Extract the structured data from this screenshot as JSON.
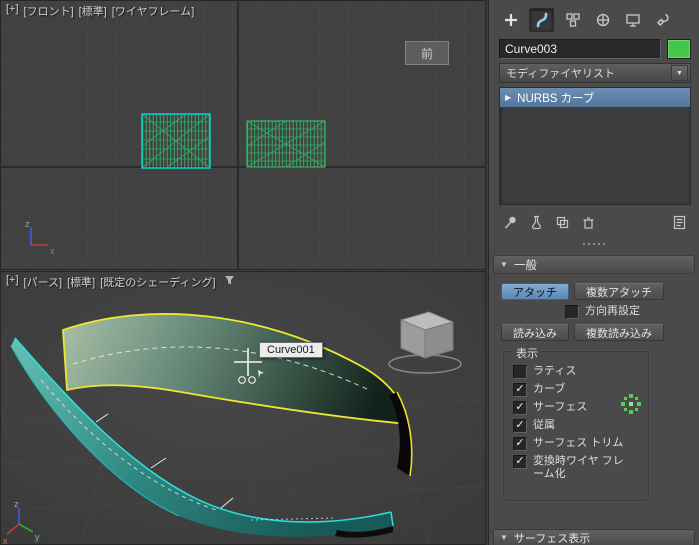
{
  "viewport_front": {
    "labels": [
      "[+]",
      "[フロント]",
      "[標準]",
      "[ワイヤフレーム]"
    ],
    "view_indicator": "前",
    "axis_labels": {
      "z": "z",
      "x": "x"
    }
  },
  "viewport_persp": {
    "labels": [
      "[+]",
      "[パース]",
      "[標準]",
      "[既定のシェーディング]"
    ],
    "tooltip": "Curve001",
    "axis_labels": {
      "z": "z",
      "x": "x",
      "y": "y"
    }
  },
  "panel": {
    "tabs": [
      {
        "name": "create"
      },
      {
        "name": "modify",
        "active": true
      },
      {
        "name": "hierarchy"
      },
      {
        "name": "motion"
      },
      {
        "name": "display"
      },
      {
        "name": "utilities"
      }
    ],
    "object_name": "Curve003",
    "object_color": "#44c648",
    "modifier_list_label": "モディファイヤリスト",
    "stack_items": [
      {
        "label": "NURBS カーブ",
        "selected": true
      }
    ],
    "stack_tools": [
      {
        "name": "pin-stack"
      },
      {
        "name": "show-end-result"
      },
      {
        "name": "make-unique"
      },
      {
        "name": "remove-modifier"
      },
      {
        "name": "configure-modifier-sets"
      }
    ],
    "general": {
      "title": "一般",
      "attach_label": "アタッチ",
      "multi_attach_label": "複数アタッチ",
      "reorient": {
        "label": "方向再設定",
        "checked": false
      },
      "import_label": "読み込み",
      "multi_import_label": "複数読み込み",
      "display_group": {
        "title": "表示",
        "items": [
          {
            "label": "ラティス",
            "checked": false
          },
          {
            "label": "カーブ",
            "checked": true
          },
          {
            "label": "サーフェス",
            "checked": true
          },
          {
            "label": "従属",
            "checked": true
          },
          {
            "label": "サーフェス トリム",
            "checked": true
          },
          {
            "label": "変換時ワイヤ フレーム化",
            "checked": true
          }
        ]
      }
    },
    "next_rollout_title": "サーフェス表示",
    "accent_color": "#5c87b5"
  }
}
